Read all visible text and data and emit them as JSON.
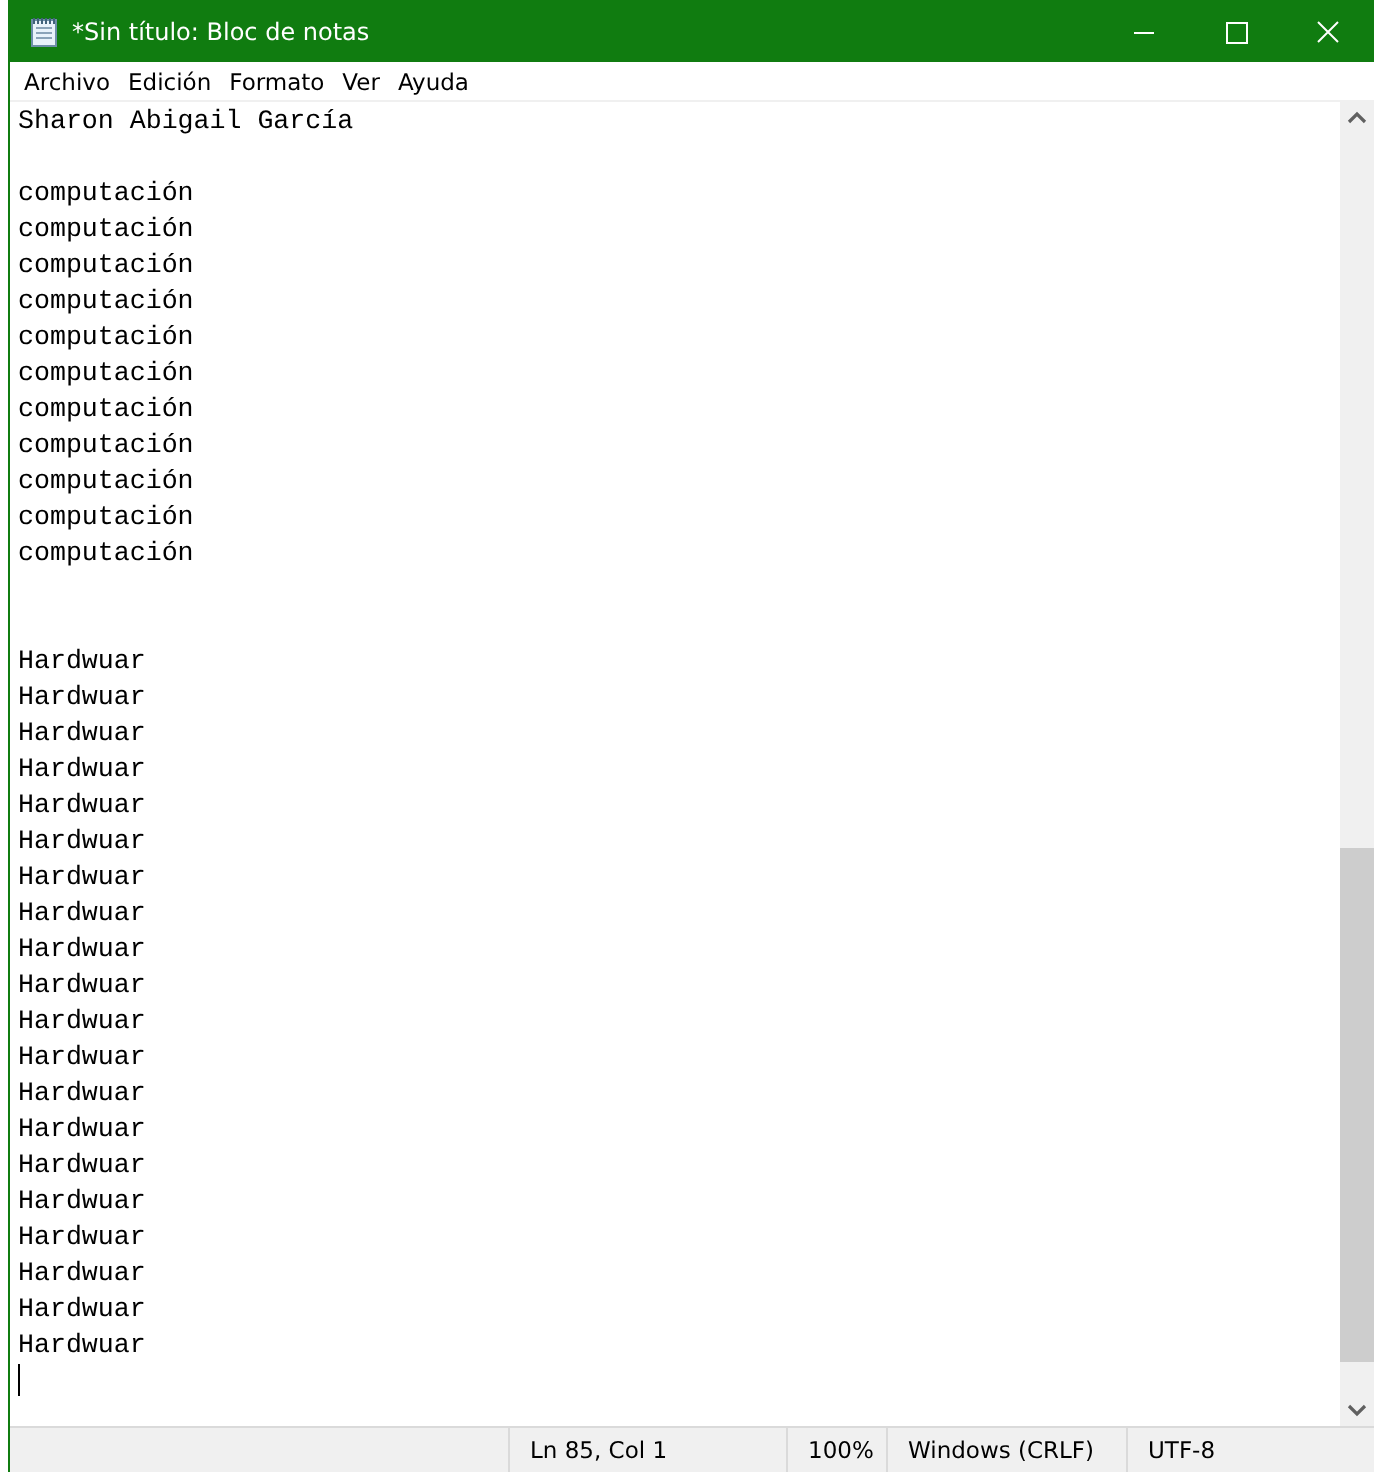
{
  "window": {
    "title": "*Sin título: Bloc de notas"
  },
  "menu": [
    "Archivo",
    "Edición",
    "Formato",
    "Ver",
    "Ayuda"
  ],
  "editor": {
    "lines": [
      {
        "kind": "text",
        "text": "Sharon Abigail García"
      },
      {
        "kind": "blank"
      },
      {
        "kind": "text",
        "text": "computación"
      },
      {
        "kind": "text",
        "text": "computación"
      },
      {
        "kind": "text",
        "text": "computación"
      },
      {
        "kind": "text",
        "text": "computación"
      },
      {
        "kind": "text",
        "text": "computación"
      },
      {
        "kind": "text",
        "text": "computación"
      },
      {
        "kind": "text",
        "text": "computación"
      },
      {
        "kind": "text",
        "text": "computación"
      },
      {
        "kind": "text",
        "text": "computación"
      },
      {
        "kind": "text",
        "text": "computación"
      },
      {
        "kind": "text",
        "text": "computación"
      },
      {
        "kind": "blank"
      },
      {
        "kind": "blank"
      },
      {
        "kind": "text",
        "text": "Hardwuar"
      },
      {
        "kind": "text",
        "text": "Hardwuar"
      },
      {
        "kind": "text",
        "text": "Hardwuar"
      },
      {
        "kind": "text",
        "text": "Hardwuar"
      },
      {
        "kind": "text",
        "text": "Hardwuar"
      },
      {
        "kind": "text",
        "text": "Hardwuar"
      },
      {
        "kind": "text",
        "text": "Hardwuar"
      },
      {
        "kind": "text",
        "text": "Hardwuar"
      },
      {
        "kind": "text",
        "text": "Hardwuar"
      },
      {
        "kind": "text",
        "text": "Hardwuar"
      },
      {
        "kind": "text",
        "text": "Hardwuar"
      },
      {
        "kind": "text",
        "text": "Hardwuar"
      },
      {
        "kind": "text",
        "text": "Hardwuar"
      },
      {
        "kind": "text",
        "text": "Hardwuar"
      },
      {
        "kind": "text",
        "text": "Hardwuar"
      },
      {
        "kind": "text",
        "text": "Hardwuar"
      },
      {
        "kind": "text",
        "text": "Hardwuar"
      },
      {
        "kind": "text",
        "text": "Hardwuar"
      },
      {
        "kind": "text",
        "text": "Hardwuar"
      },
      {
        "kind": "text",
        "text": "Hardwuar"
      },
      {
        "kind": "cursor"
      }
    ]
  },
  "status_bar": {
    "position": "Ln 85, Col 1",
    "zoom": "100%",
    "line_ending": "Windows (CRLF)",
    "encoding": "UTF-8"
  }
}
